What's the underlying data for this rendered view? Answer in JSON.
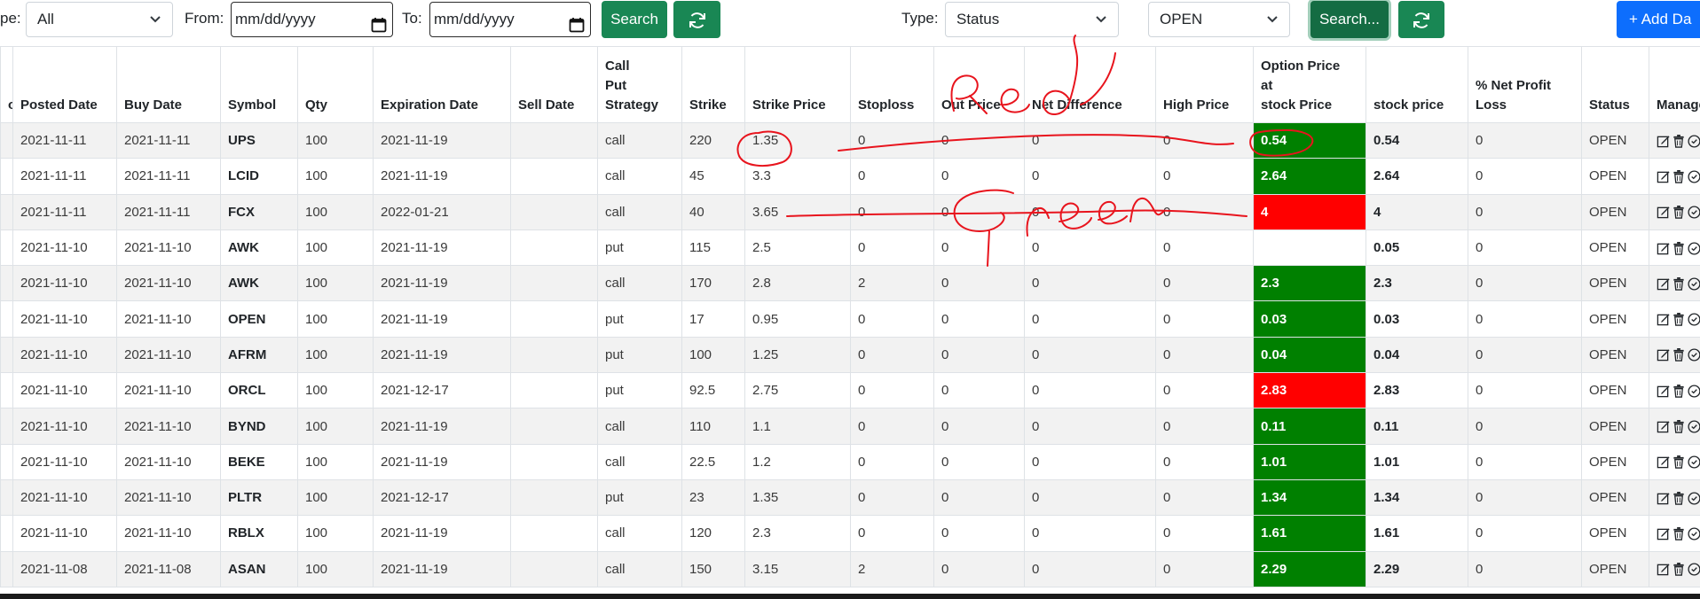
{
  "toolbar": {
    "type_label_1": "pe:",
    "type_select_1": "All",
    "from_label": "From:",
    "from_placeholder": "mm/dd/yyyy",
    "to_label": "To:",
    "to_placeholder": "mm/dd/yyyy",
    "search_label": "Search",
    "type_label_2": "Type:",
    "type_select_2": "Status",
    "status_select": "OPEN",
    "search2_label": "Search...",
    "add_label": "+ Add Da"
  },
  "colors": {
    "green": "#008000",
    "red": "#ff0000",
    "button": "#198754",
    "blue": "#0d6efd"
  },
  "table": {
    "headers": [
      "o",
      "Posted Date",
      "Buy Date",
      "Symbol",
      "Qty",
      "Expiration Date",
      "Sell Date",
      "Call\nPut\nStrategy",
      "Strike",
      "Strike Price",
      "Stoploss",
      "Out Price",
      "Net Difference",
      "High Price",
      "Option Price\n at\nstock Price",
      "stock price",
      "% Net Profit\nLoss",
      "Status",
      "Manage"
    ],
    "rows": [
      {
        "posted": "2021-11-11",
        "buy": "2021-11-11",
        "symbol": "UPS",
        "qty": "100",
        "exp": "2021-11-19",
        "sell": "",
        "cp": "call",
        "strike": "220",
        "strike_price": "1.35",
        "stoploss": "0",
        "out": "0",
        "net": "0",
        "high": "0",
        "opt": "0.54",
        "opt_color": "green",
        "stock": "0.54",
        "pct": "0",
        "status": "OPEN"
      },
      {
        "posted": "2021-11-11",
        "buy": "2021-11-11",
        "symbol": "LCID",
        "qty": "100",
        "exp": "2021-11-19",
        "sell": "",
        "cp": "call",
        "strike": "45",
        "strike_price": "3.3",
        "stoploss": "0",
        "out": "0",
        "net": "0",
        "high": "0",
        "opt": "2.64",
        "opt_color": "green",
        "stock": "2.64",
        "pct": "0",
        "status": "OPEN"
      },
      {
        "posted": "2021-11-11",
        "buy": "2021-11-11",
        "symbol": "FCX",
        "qty": "100",
        "exp": "2022-01-21",
        "sell": "",
        "cp": "call",
        "strike": "40",
        "strike_price": "3.65",
        "stoploss": "0",
        "out": "0",
        "net": "0",
        "high": "0",
        "opt": "4",
        "opt_color": "red",
        "stock": "4",
        "pct": "0",
        "status": "OPEN"
      },
      {
        "posted": "2021-11-10",
        "buy": "2021-11-10",
        "symbol": "AWK",
        "qty": "100",
        "exp": "2021-11-19",
        "sell": "",
        "cp": "put",
        "strike": "115",
        "strike_price": "2.5",
        "stoploss": "0",
        "out": "0",
        "net": "0",
        "high": "0",
        "opt": "",
        "opt_color": "blank",
        "stock": "0.05",
        "pct": "0",
        "status": "OPEN"
      },
      {
        "posted": "2021-11-10",
        "buy": "2021-11-10",
        "symbol": "AWK",
        "qty": "100",
        "exp": "2021-11-19",
        "sell": "",
        "cp": "call",
        "strike": "170",
        "strike_price": "2.8",
        "stoploss": "2",
        "out": "0",
        "net": "0",
        "high": "0",
        "opt": "2.3",
        "opt_color": "green",
        "stock": "2.3",
        "pct": "0",
        "status": "OPEN"
      },
      {
        "posted": "2021-11-10",
        "buy": "2021-11-10",
        "symbol": "OPEN",
        "qty": "100",
        "exp": "2021-11-19",
        "sell": "",
        "cp": "put",
        "strike": "17",
        "strike_price": "0.95",
        "stoploss": "0",
        "out": "0",
        "net": "0",
        "high": "0",
        "opt": "0.03",
        "opt_color": "green",
        "stock": "0.03",
        "pct": "0",
        "status": "OPEN"
      },
      {
        "posted": "2021-11-10",
        "buy": "2021-11-10",
        "symbol": "AFRM",
        "qty": "100",
        "exp": "2021-11-19",
        "sell": "",
        "cp": "put",
        "strike": "100",
        "strike_price": "1.25",
        "stoploss": "0",
        "out": "0",
        "net": "0",
        "high": "0",
        "opt": "0.04",
        "opt_color": "green",
        "stock": "0.04",
        "pct": "0",
        "status": "OPEN"
      },
      {
        "posted": "2021-11-10",
        "buy": "2021-11-10",
        "symbol": "ORCL",
        "qty": "100",
        "exp": "2021-12-17",
        "sell": "",
        "cp": "put",
        "strike": "92.5",
        "strike_price": "2.75",
        "stoploss": "0",
        "out": "0",
        "net": "0",
        "high": "0",
        "opt": "2.83",
        "opt_color": "red",
        "stock": "2.83",
        "pct": "0",
        "status": "OPEN"
      },
      {
        "posted": "2021-11-10",
        "buy": "2021-11-10",
        "symbol": "BYND",
        "qty": "100",
        "exp": "2021-11-19",
        "sell": "",
        "cp": "call",
        "strike": "110",
        "strike_price": "1.1",
        "stoploss": "0",
        "out": "0",
        "net": "0",
        "high": "0",
        "opt": "0.11",
        "opt_color": "green",
        "stock": "0.11",
        "pct": "0",
        "status": "OPEN"
      },
      {
        "posted": "2021-11-10",
        "buy": "2021-11-10",
        "symbol": "BEKE",
        "qty": "100",
        "exp": "2021-11-19",
        "sell": "",
        "cp": "call",
        "strike": "22.5",
        "strike_price": "1.2",
        "stoploss": "0",
        "out": "0",
        "net": "0",
        "high": "0",
        "opt": "1.01",
        "opt_color": "green",
        "stock": "1.01",
        "pct": "0",
        "status": "OPEN"
      },
      {
        "posted": "2021-11-10",
        "buy": "2021-11-10",
        "symbol": "PLTR",
        "qty": "100",
        "exp": "2021-12-17",
        "sell": "",
        "cp": "put",
        "strike": "23",
        "strike_price": "1.35",
        "stoploss": "0",
        "out": "0",
        "net": "0",
        "high": "0",
        "opt": "1.34",
        "opt_color": "green",
        "stock": "1.34",
        "pct": "0",
        "status": "OPEN"
      },
      {
        "posted": "2021-11-10",
        "buy": "2021-11-10",
        "symbol": "RBLX",
        "qty": "100",
        "exp": "2021-11-19",
        "sell": "",
        "cp": "call",
        "strike": "120",
        "strike_price": "2.3",
        "stoploss": "0",
        "out": "0",
        "net": "0",
        "high": "0",
        "opt": "1.61",
        "opt_color": "green",
        "stock": "1.61",
        "pct": "0",
        "status": "OPEN"
      },
      {
        "posted": "2021-11-08",
        "buy": "2021-11-08",
        "symbol": "ASAN",
        "qty": "100",
        "exp": "2021-11-19",
        "sell": "",
        "cp": "call",
        "strike": "150",
        "strike_price": "3.15",
        "stoploss": "2",
        "out": "0",
        "net": "0",
        "high": "0",
        "opt": "2.29",
        "opt_color": "green",
        "stock": "2.29",
        "pct": "0",
        "status": "OPEN"
      }
    ]
  },
  "annotation": {
    "word_1": "Red",
    "word_2": "Green",
    "ink_color": "#e8141d"
  }
}
